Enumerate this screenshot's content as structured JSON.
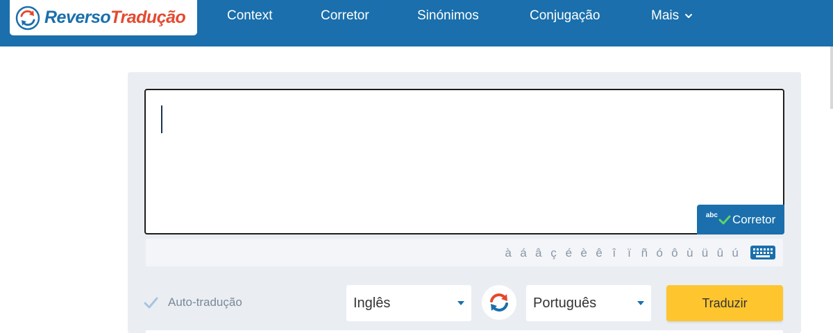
{
  "brand": {
    "name_part1": "Reverso",
    "name_part2": "Tradução",
    "color_primary": "#1a6fac",
    "color_accent": "#e4492f"
  },
  "nav": {
    "items": [
      {
        "label": "Context"
      },
      {
        "label": "Corretor"
      },
      {
        "label": "Sinónimos"
      },
      {
        "label": "Conjugação"
      },
      {
        "label": "Mais"
      }
    ]
  },
  "editor": {
    "value": "",
    "corretor_abc": "abc",
    "corretor_label": "Corretor"
  },
  "accents": [
    "à",
    "á",
    "â",
    "ç",
    "é",
    "è",
    "ê",
    "î",
    "ï",
    "ñ",
    "ó",
    "ô",
    "ù",
    "ü",
    "û",
    "ú"
  ],
  "icons": {
    "logo": "reverso-swap-logo-icon",
    "keyboard": "keyboard-icon",
    "swap": "swap-languages-icon",
    "check": "checkmark-icon",
    "dropdown": "chevron-down-icon"
  },
  "controls": {
    "auto_translate_label": "Auto-tradução",
    "auto_translate_checked": true,
    "source_language": "Inglês",
    "target_language": "Português",
    "translate_button": "Traduzir",
    "translate_color": "#fec52e"
  }
}
